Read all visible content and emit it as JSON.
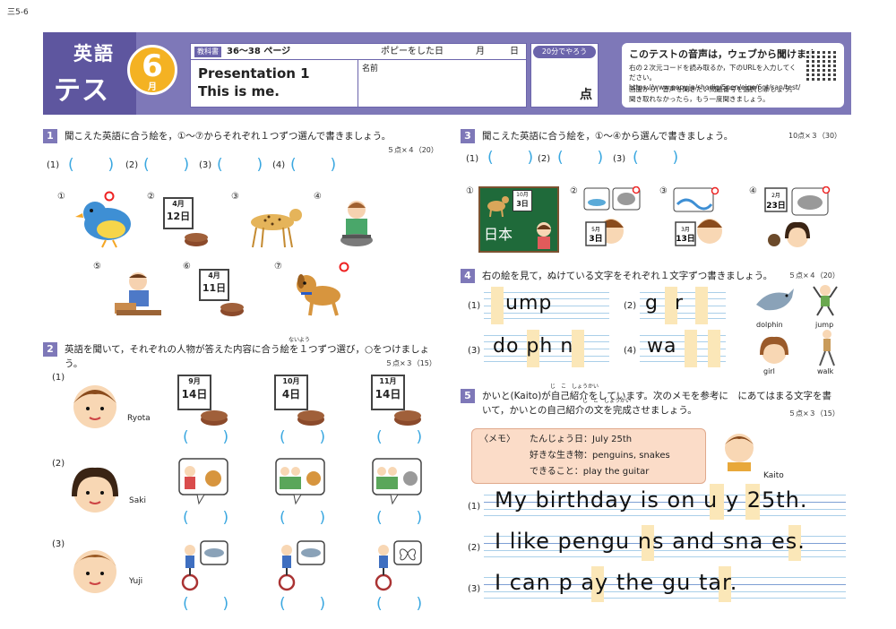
{
  "page_code": "三5-6",
  "header": {
    "badge_line1": "英語",
    "badge_line2": "テスト",
    "month_num": "6",
    "month_label": "月",
    "textbook_tag": "教科書",
    "pages": "36〜38 ページ",
    "poppy_done": "ポピーをした日",
    "month": "月",
    "day": "日",
    "title1": "Presentation 1",
    "title2": "This is me.",
    "name_label": "名前",
    "time_label": "20分でやろう",
    "score_unit": "点",
    "audio_title": "このテストの音声は，ウェブから聞けます。",
    "audio_text1": "右の２次元コードを読み取るか，下のURLを入力してください。https://www.popy.jp/shodig/5nen/eige/6gt/san/test/",
    "audio_text2": "画面から，音声を聞きたい問題番号を選択しましょう。聞き取れなかったら，もう一度聞きましょう。"
  },
  "q1": {
    "num": "1",
    "text": "聞こえた英語に合う絵を，①〜⑦からそれぞれ１つずつ選んで書きましょう。",
    "points": "５点×４（20）",
    "answers": [
      "(1)",
      "(2)",
      "(3)",
      "(4)"
    ],
    "pics": [
      "①",
      "②",
      "③",
      "④",
      "⑤",
      "⑥",
      "⑦"
    ],
    "cal1": {
      "m": "4月",
      "d": "12日"
    },
    "cal2": {
      "m": "4月",
      "d": "11日"
    }
  },
  "q2": {
    "num": "2",
    "text": "英語を聞いて，それぞれの人物が答えた内容に合う絵を１つずつ選び，○をつけましょう。",
    "points": "５点×３（15）",
    "ruby": "ないよう",
    "people": [
      "Ryota",
      "Saki",
      "Yuji"
    ],
    "rows": [
      "(1)",
      "(2)",
      "(3)"
    ],
    "cals": [
      {
        "m": "9月",
        "d": "14日"
      },
      {
        "m": "10月",
        "d": "4日"
      },
      {
        "m": "11月",
        "d": "14日"
      }
    ]
  },
  "q3": {
    "num": "3",
    "text": "聞こえた英語に合う絵を，①〜④から選んで書きましょう。",
    "points": "10点×３（30）",
    "answers": [
      "(1)",
      "(2)",
      "(3)"
    ],
    "pics": [
      "①",
      "②",
      "③",
      "④"
    ],
    "cals": [
      {
        "m": "10月",
        "d": "3日"
      },
      {
        "m": "5月",
        "d": "3日"
      },
      {
        "m": "3月",
        "d": "13日"
      },
      {
        "m": "2月",
        "d": "23日"
      }
    ],
    "japan": "日本"
  },
  "q4": {
    "num": "4",
    "text": "右の絵を見て，ぬけている文字をそれぞれ１文字ずつ書きましょう。",
    "points": "５点×４（20）",
    "labels": [
      "(1)",
      "(2)",
      "(3)",
      "(4)"
    ],
    "words": [
      "ump",
      "g r",
      "do ph n",
      "wa"
    ],
    "captions": [
      "dolphin",
      "jump",
      "girl",
      "walk"
    ]
  },
  "q5": {
    "num": "5",
    "text": "かいと(Kaito)が自己紹介をしています。次のメモを参考に　にあてはまる文字を書いて，かいとの自己紹介の文を完成させましょう。",
    "points": "５点×３（15）",
    "ruby1": "じ　こ　しょうかい",
    "ruby2": "じ　こ　しょうかい",
    "memo_title": "〈メモ〉",
    "memo": [
      "たんじょう日：July 25th",
      "好きな生き物：penguins, snakes",
      "できること：play the guitar"
    ],
    "kaito": "Kaito",
    "labels": [
      "(1)",
      "(2)",
      "(3)"
    ],
    "sentences": [
      "My birthday is on  u y 25th.",
      "I like pengu ns and sna es.",
      "I can p ay the gu tar."
    ]
  }
}
